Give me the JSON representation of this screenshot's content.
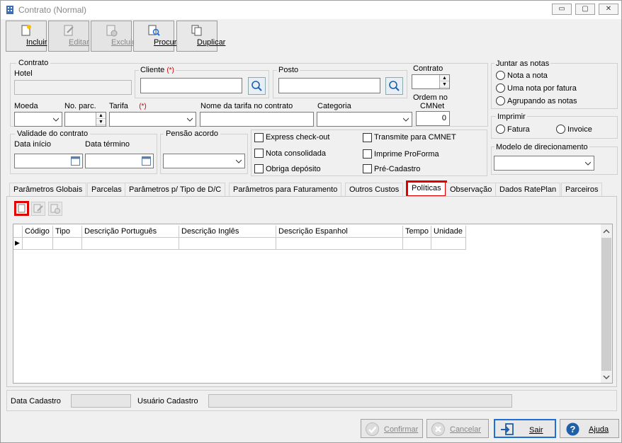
{
  "window": {
    "title": "Contrato (Normal)",
    "min_label": "▭",
    "restore_label": "▢",
    "close_label": "✕"
  },
  "toolbar": {
    "incluir": "Incluir",
    "editar": "Editar",
    "excluir": "Excluir",
    "procurar": "Procurar",
    "duplicar": "Duplicar"
  },
  "contrato_group": {
    "legend": "Contrato",
    "hotel_label": "Hotel",
    "cliente_label": "Cliente",
    "posto_label": "Posto",
    "contrato_label": "Contrato",
    "ordem_label": "Ordem no",
    "cmnet_label": "CMNet",
    "ordem_value": "0",
    "moeda_label": "Moeda",
    "noparc_label": "No. parc.",
    "tarifa_label": "Tarifa",
    "nome_tarifa_label": "Nome da tarifa no contrato",
    "categoria_label": "Categoria",
    "required_mark": "(*)"
  },
  "validade": {
    "legend": "Validade do contrato",
    "inicio_label": "Data início",
    "termino_label": "Data término"
  },
  "pensao": {
    "legend": "Pensão acordo"
  },
  "checks": {
    "express": "Express check-out",
    "nota_consolidada": "Nota consolidada",
    "obriga_deposito": "Obriga depósito",
    "transmite": "Transmite para CMNET",
    "proforma": "Imprime ProForma",
    "pre_cadastro": "Pré-Cadastro"
  },
  "juntar": {
    "legend": "Juntar as notas",
    "opt1": "Nota a nota",
    "opt2": "Uma nota por fatura",
    "opt3": "Agrupando as notas"
  },
  "imprimir": {
    "legend": "Imprimir",
    "opt1": "Fatura",
    "opt2": "Invoice"
  },
  "modelo": {
    "legend": "Modelo de direcionamento"
  },
  "tabs": [
    "Parâmetros Globais",
    "Parcelas",
    "Parâmetros p/ Tipo de D/C",
    "Parâmetros para Faturamento",
    "Outros Custos",
    "Políticas",
    "Observação",
    "Dados RatePlan",
    "Parceiros"
  ],
  "grid": {
    "columns": [
      "Código",
      "Tipo",
      "Descrição Português",
      "Descrição Inglês",
      "Descrição Espanhol",
      "Tempo",
      "Unidade"
    ],
    "row_indicator": "▶"
  },
  "footer": {
    "data_cadastro_label": "Data Cadastro",
    "usuario_cadastro_label": "Usuário Cadastro"
  },
  "buttons": {
    "confirmar": "Confirmar",
    "cancelar": "Cancelar",
    "sair": "Sair",
    "ajuda": "Ajuda"
  },
  "colors": {
    "highlight": "#e00000",
    "accent": "#1e6fd9"
  }
}
